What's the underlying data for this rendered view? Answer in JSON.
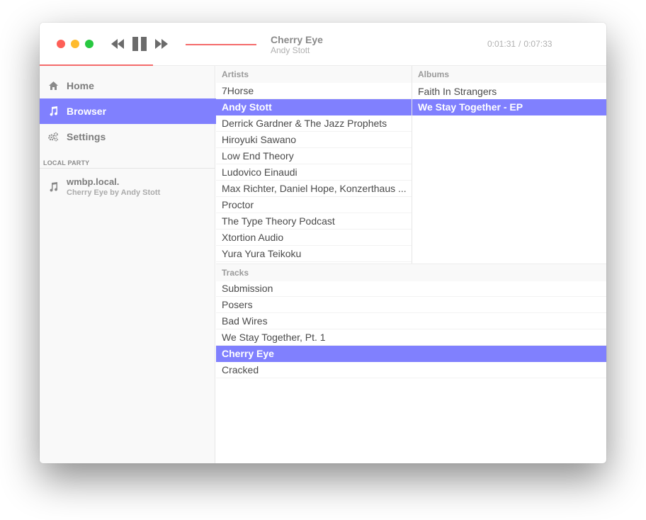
{
  "window": {
    "close_label": "close",
    "minimize_label": "minimize",
    "maximize_label": "maximize"
  },
  "player": {
    "track_title": "Cherry Eye",
    "track_artist": "Andy Stott",
    "elapsed": "0:01:31",
    "separator": "/",
    "duration": "0:07:33",
    "progress": 0.2
  },
  "icons": {
    "rewind": "rewind-icon",
    "pause": "pause-icon",
    "fast_forward": "fast-forward-icon",
    "home": "home-icon",
    "music": "music-note-icon",
    "settings": "gears-icon"
  },
  "colors": {
    "accent": "#8080fe",
    "progress": "#f46b6b"
  },
  "sidebar": {
    "items": [
      {
        "label": "Home",
        "active": false
      },
      {
        "label": "Browser",
        "active": true
      },
      {
        "label": "Settings",
        "active": false
      }
    ],
    "section_title": "LOCAL PARTY",
    "party": {
      "name": "wmbp.local.",
      "now_playing": "Cherry Eye by Andy Stott"
    }
  },
  "browser": {
    "artists": {
      "header": "Artists",
      "items": [
        "7Horse",
        "Andy Stott",
        "Derrick Gardner & The Jazz Prophets",
        "Hiroyuki Sawano",
        "Low End Theory",
        "Ludovico Einaudi",
        "Max Richter, Daniel Hope, Konzerthaus ...",
        "Proctor",
        "The Type Theory Podcast",
        "Xtortion Audio",
        "Yura Yura Teikoku"
      ],
      "selected": "Andy Stott"
    },
    "albums": {
      "header": "Albums",
      "items": [
        "Faith In Strangers",
        "We Stay Together - EP"
      ],
      "selected": "We Stay Together - EP"
    },
    "tracks": {
      "header": "Tracks",
      "items": [
        "Submission",
        "Posers",
        "Bad Wires",
        "We Stay Together, Pt. 1",
        "Cherry Eye",
        "Cracked"
      ],
      "selected": "Cherry Eye"
    }
  }
}
